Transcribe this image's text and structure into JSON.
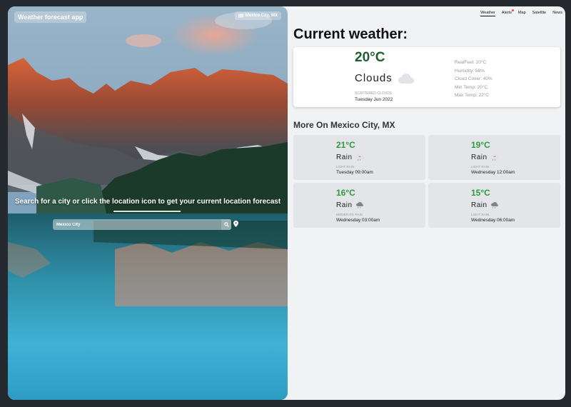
{
  "app": {
    "title": "Weather forecast app",
    "location_pill": "Mexico City, MX"
  },
  "search": {
    "prompt": "Search for a city or click the location icon to get your current location forecast",
    "value": "Mexico City"
  },
  "nav": {
    "items": [
      "Weather",
      "Alerts",
      "Map",
      "Satellite",
      "News"
    ],
    "active": "Weather"
  },
  "current": {
    "heading": "Current weather:",
    "temp": "20°C",
    "condition": "Clouds",
    "description": "scattered clouds",
    "date": "Tuesday Jun 2022",
    "details": [
      "RealFeel: 20°C",
      "Humidity: 58%",
      "Cloud Cover: 40%",
      "Min Temp: 20°C",
      "Max Temp: 22°C"
    ]
  },
  "more": {
    "heading": "More On Mexico City, MX",
    "forecasts": [
      {
        "temp": "21°C",
        "condition": "Rain",
        "description": "light rain",
        "time": "Tuesday 09:00am",
        "icon": "rain-icon"
      },
      {
        "temp": "19°C",
        "condition": "Rain",
        "description": "light rain",
        "time": "Wednesday 12:00am",
        "icon": "rain-icon"
      },
      {
        "temp": "16°C",
        "condition": "Rain",
        "description": "moderate rain",
        "time": "Wednesday 03:00am",
        "icon": "rain-icon"
      },
      {
        "temp": "15°C",
        "condition": "Rain",
        "description": "light rain",
        "time": "Wednesday 06:00am",
        "icon": "rain-icon"
      }
    ]
  },
  "colors": {
    "accent_temp": "#1f5e2c",
    "forecast_temp": "#2e9a3c",
    "page_bg": "#f1f2f4",
    "card_bg": "#e4e5e8"
  }
}
